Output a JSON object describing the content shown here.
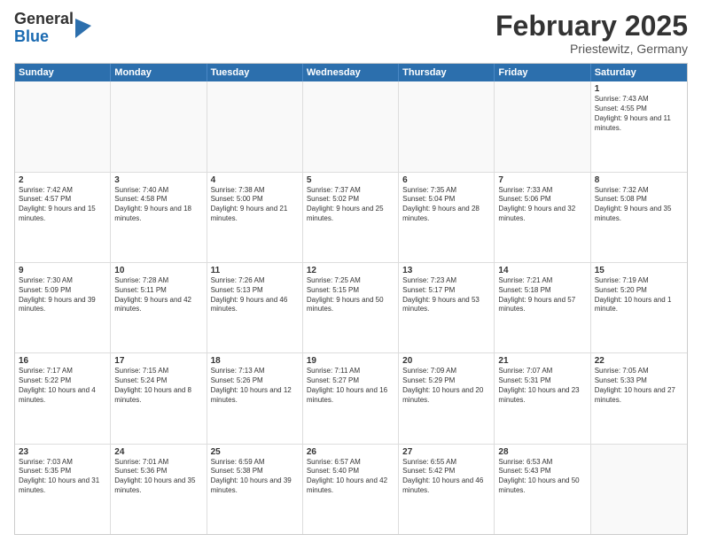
{
  "header": {
    "logo_general": "General",
    "logo_blue": "Blue",
    "month_title": "February 2025",
    "location": "Priestewitz, Germany"
  },
  "days_of_week": [
    "Sunday",
    "Monday",
    "Tuesday",
    "Wednesday",
    "Thursday",
    "Friday",
    "Saturday"
  ],
  "weeks": [
    [
      {
        "num": "",
        "empty": true,
        "text": ""
      },
      {
        "num": "",
        "empty": true,
        "text": ""
      },
      {
        "num": "",
        "empty": true,
        "text": ""
      },
      {
        "num": "",
        "empty": true,
        "text": ""
      },
      {
        "num": "",
        "empty": true,
        "text": ""
      },
      {
        "num": "",
        "empty": true,
        "text": ""
      },
      {
        "num": "1",
        "text": "Sunrise: 7:43 AM\nSunset: 4:55 PM\nDaylight: 9 hours and 11 minutes."
      }
    ],
    [
      {
        "num": "2",
        "text": "Sunrise: 7:42 AM\nSunset: 4:57 PM\nDaylight: 9 hours and 15 minutes."
      },
      {
        "num": "3",
        "text": "Sunrise: 7:40 AM\nSunset: 4:58 PM\nDaylight: 9 hours and 18 minutes."
      },
      {
        "num": "4",
        "text": "Sunrise: 7:38 AM\nSunset: 5:00 PM\nDaylight: 9 hours and 21 minutes."
      },
      {
        "num": "5",
        "text": "Sunrise: 7:37 AM\nSunset: 5:02 PM\nDaylight: 9 hours and 25 minutes."
      },
      {
        "num": "6",
        "text": "Sunrise: 7:35 AM\nSunset: 5:04 PM\nDaylight: 9 hours and 28 minutes."
      },
      {
        "num": "7",
        "text": "Sunrise: 7:33 AM\nSunset: 5:06 PM\nDaylight: 9 hours and 32 minutes."
      },
      {
        "num": "8",
        "text": "Sunrise: 7:32 AM\nSunset: 5:08 PM\nDaylight: 9 hours and 35 minutes."
      }
    ],
    [
      {
        "num": "9",
        "text": "Sunrise: 7:30 AM\nSunset: 5:09 PM\nDaylight: 9 hours and 39 minutes."
      },
      {
        "num": "10",
        "text": "Sunrise: 7:28 AM\nSunset: 5:11 PM\nDaylight: 9 hours and 42 minutes."
      },
      {
        "num": "11",
        "text": "Sunrise: 7:26 AM\nSunset: 5:13 PM\nDaylight: 9 hours and 46 minutes."
      },
      {
        "num": "12",
        "text": "Sunrise: 7:25 AM\nSunset: 5:15 PM\nDaylight: 9 hours and 50 minutes."
      },
      {
        "num": "13",
        "text": "Sunrise: 7:23 AM\nSunset: 5:17 PM\nDaylight: 9 hours and 53 minutes."
      },
      {
        "num": "14",
        "text": "Sunrise: 7:21 AM\nSunset: 5:18 PM\nDaylight: 9 hours and 57 minutes."
      },
      {
        "num": "15",
        "text": "Sunrise: 7:19 AM\nSunset: 5:20 PM\nDaylight: 10 hours and 1 minute."
      }
    ],
    [
      {
        "num": "16",
        "text": "Sunrise: 7:17 AM\nSunset: 5:22 PM\nDaylight: 10 hours and 4 minutes."
      },
      {
        "num": "17",
        "text": "Sunrise: 7:15 AM\nSunset: 5:24 PM\nDaylight: 10 hours and 8 minutes."
      },
      {
        "num": "18",
        "text": "Sunrise: 7:13 AM\nSunset: 5:26 PM\nDaylight: 10 hours and 12 minutes."
      },
      {
        "num": "19",
        "text": "Sunrise: 7:11 AM\nSunset: 5:27 PM\nDaylight: 10 hours and 16 minutes."
      },
      {
        "num": "20",
        "text": "Sunrise: 7:09 AM\nSunset: 5:29 PM\nDaylight: 10 hours and 20 minutes."
      },
      {
        "num": "21",
        "text": "Sunrise: 7:07 AM\nSunset: 5:31 PM\nDaylight: 10 hours and 23 minutes."
      },
      {
        "num": "22",
        "text": "Sunrise: 7:05 AM\nSunset: 5:33 PM\nDaylight: 10 hours and 27 minutes."
      }
    ],
    [
      {
        "num": "23",
        "text": "Sunrise: 7:03 AM\nSunset: 5:35 PM\nDaylight: 10 hours and 31 minutes."
      },
      {
        "num": "24",
        "text": "Sunrise: 7:01 AM\nSunset: 5:36 PM\nDaylight: 10 hours and 35 minutes."
      },
      {
        "num": "25",
        "text": "Sunrise: 6:59 AM\nSunset: 5:38 PM\nDaylight: 10 hours and 39 minutes."
      },
      {
        "num": "26",
        "text": "Sunrise: 6:57 AM\nSunset: 5:40 PM\nDaylight: 10 hours and 42 minutes."
      },
      {
        "num": "27",
        "text": "Sunrise: 6:55 AM\nSunset: 5:42 PM\nDaylight: 10 hours and 46 minutes."
      },
      {
        "num": "28",
        "text": "Sunrise: 6:53 AM\nSunset: 5:43 PM\nDaylight: 10 hours and 50 minutes."
      },
      {
        "num": "",
        "empty": true,
        "text": ""
      }
    ]
  ]
}
